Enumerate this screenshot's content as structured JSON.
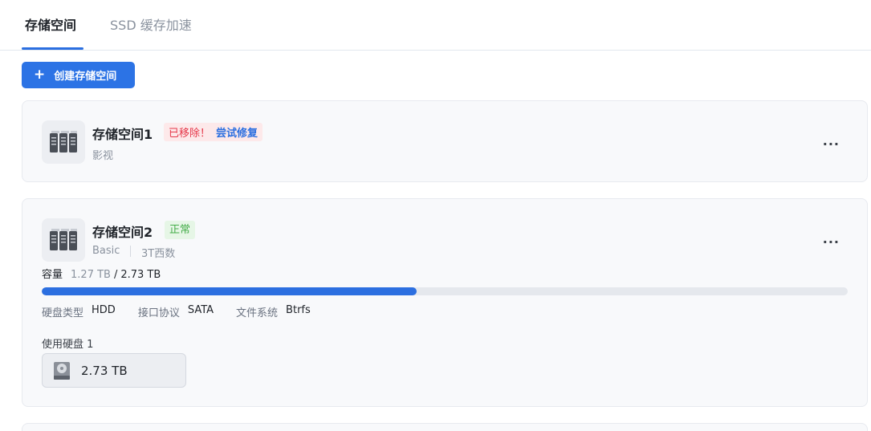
{
  "tabs": [
    {
      "label": "存储空间",
      "active": true
    },
    {
      "label": "SSD 缓存加速",
      "active": false
    }
  ],
  "create_button": {
    "icon": "plus-icon",
    "label": "创建存储空间"
  },
  "colors": {
    "accent": "#2c6fe0",
    "error": "#e5384a",
    "success": "#45ad4a"
  },
  "spaces": [
    {
      "title": "存储空间1",
      "status_error": "已移除！",
      "repair_link": "尝试修复",
      "description": "影视",
      "icon": "nas-server-icon"
    },
    {
      "title": "存储空间2",
      "status": "正常",
      "raid_type": "Basic",
      "description": "3T西数",
      "icon": "nas-server-icon",
      "capacity_label": "容量",
      "used": "1.27 TB",
      "separator": "/",
      "total": "2.73 TB",
      "usage_fraction": 0.465,
      "properties": [
        {
          "key": "硬盘类型",
          "value": "HDD"
        },
        {
          "key": "接口协议",
          "value": "SATA"
        },
        {
          "key": "文件系统",
          "value": "Btrfs"
        }
      ],
      "disks_label": "使用硬盘 1",
      "disks": [
        {
          "size": "2.73 TB",
          "icon": "hard-disk-icon"
        }
      ]
    }
  ],
  "more_icon": "..."
}
